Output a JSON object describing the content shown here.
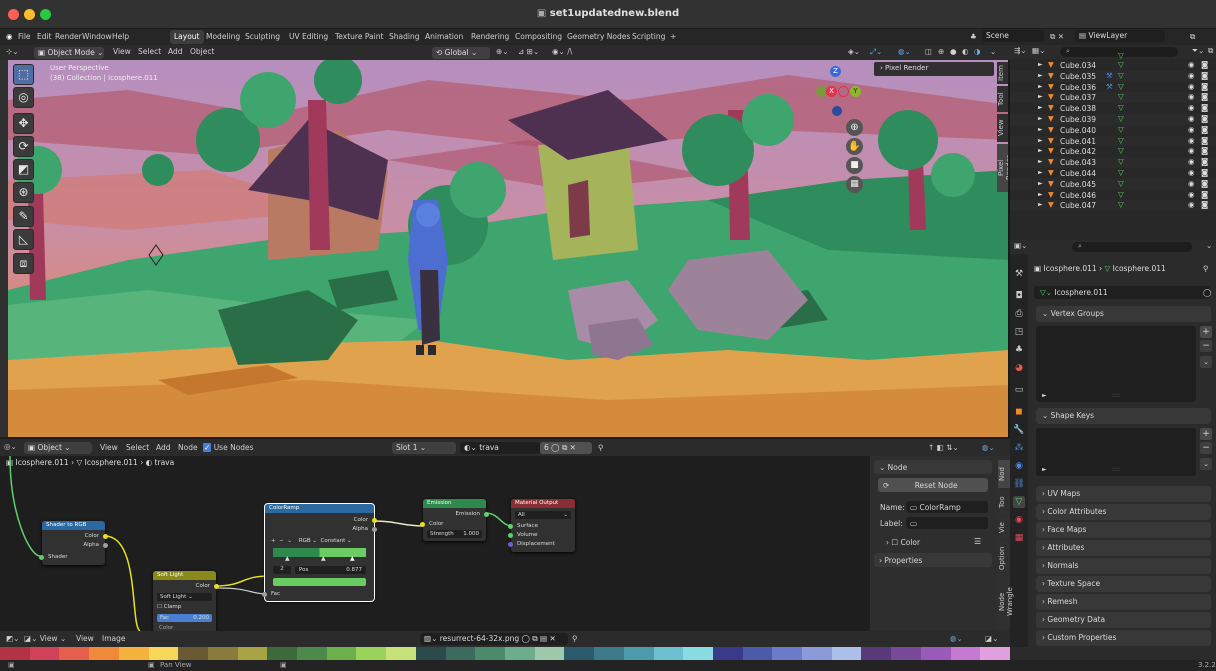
{
  "window": {
    "title": "set1updatednew.blend"
  },
  "menu": {
    "items": [
      "File",
      "Edit",
      "Render",
      "Window",
      "Help"
    ],
    "workspaces": [
      "Layout",
      "Modeling",
      "Sculpting",
      "UV Editing",
      "Texture Paint",
      "Shading",
      "Animation",
      "Rendering",
      "Compositing",
      "Geometry Nodes",
      "Scripting"
    ],
    "add": "+",
    "scene": "Scene",
    "view_layer": "ViewLayer"
  },
  "viewport_header": {
    "mode": "Object Mode",
    "view": "View",
    "select": "Select",
    "add": "Add",
    "object": "Object",
    "transform": "Global"
  },
  "viewport": {
    "perspective": "User Perspective",
    "collection": "(38) Collection | Icosphere.011",
    "n_panel_title": "Pixel Render",
    "side_tabs": [
      "Item",
      "Tool",
      "View",
      "Pixel Render"
    ]
  },
  "outliner": {
    "rows": [
      "Cube.034",
      "Cube.035",
      "Cube.036",
      "Cube.037",
      "Cube.038",
      "Cube.039",
      "Cube.040",
      "Cube.041",
      "Cube.042",
      "Cube.043",
      "Cube.044",
      "Cube.045",
      "Cube.046",
      "Cube.047"
    ]
  },
  "properties": {
    "breadcrumb_obj": "Icosphere.011",
    "breadcrumb_mesh": "Icosphere.011",
    "mesh_name": "Icosphere.011",
    "sections": [
      "Vertex Groups",
      "Shape Keys",
      "UV Maps",
      "Color Attributes",
      "Face Maps",
      "Attributes",
      "Normals",
      "Texture Space",
      "Remesh",
      "Geometry Data",
      "Custom Properties"
    ],
    "list_dots": "::::",
    "version": "3.2.2"
  },
  "node_header": {
    "object": "Object",
    "view": "View",
    "select": "Select",
    "add": "Add",
    "node": "Node",
    "use_nodes": "Use Nodes",
    "slot": "Slot 1",
    "material": "trava",
    "users": "6"
  },
  "node_breadcrumb": {
    "obj": "Icosphere.011",
    "mesh": "Icosphere.011",
    "mat": "trava"
  },
  "nodes": {
    "shader_rgb": {
      "title": "Shader to RGB",
      "out1": "Color",
      "out2": "Alpha",
      "in1": "Shader"
    },
    "soft_light": {
      "title": "Soft Light",
      "out": "Color",
      "blend": "Soft Light",
      "clamp": "Clamp",
      "fac_label": "Fac",
      "fac": "0.200",
      "color": "Color"
    },
    "colorramp": {
      "title": "ColorRamp",
      "out1": "Color",
      "out2": "Alpha",
      "mode": "RGB",
      "interp": "Constant",
      "index": "2",
      "pos_label": "Pos",
      "pos": "0.877",
      "in": "Fac"
    },
    "emission": {
      "title": "Emission",
      "out": "Emission",
      "in1": "Color",
      "strength_label": "Strength",
      "strength": "1.000"
    },
    "output": {
      "title": "Material Output",
      "target": "All",
      "in1": "Surface",
      "in2": "Volume",
      "in3": "Displacement"
    }
  },
  "node_panel": {
    "section": "Node",
    "reset": "Reset Node",
    "name_label": "Name:",
    "name": "ColorRamp",
    "label_label": "Label:",
    "color": "Color",
    "properties": "Properties",
    "tabs": [
      "Nod",
      "Too",
      "Vie",
      "Option",
      "Node Wrangle"
    ]
  },
  "image_header": {
    "view1": "View",
    "view2": "View",
    "image": "Image",
    "image_name": "resurrect-64-32x.png"
  },
  "palette": {
    "colors": [
      "#b23246",
      "#d1415a",
      "#e45f4c",
      "#f08a3a",
      "#f5b23c",
      "#f7d75a",
      "#6a5a34",
      "#8a7a3c",
      "#a8a344",
      "#3c6a3c",
      "#4c8a4c",
      "#6cb04c",
      "#9ad35a",
      "#c7e27a",
      "#2c4a4c",
      "#3c6a5c",
      "#4c8a6c",
      "#6cae8c",
      "#9ccaaa",
      "#2a5a6c",
      "#3c7a8c",
      "#4c9aac",
      "#6cc0d0",
      "#8adce4",
      "#3a3a8a",
      "#4c5aaa",
      "#6c7aca",
      "#8c9ada",
      "#aac0ea",
      "#5a3a7a",
      "#7a4a9a",
      "#9a5aba",
      "#c47ad0",
      "#e0a0e0"
    ]
  },
  "status": {
    "left": "Pan View"
  }
}
